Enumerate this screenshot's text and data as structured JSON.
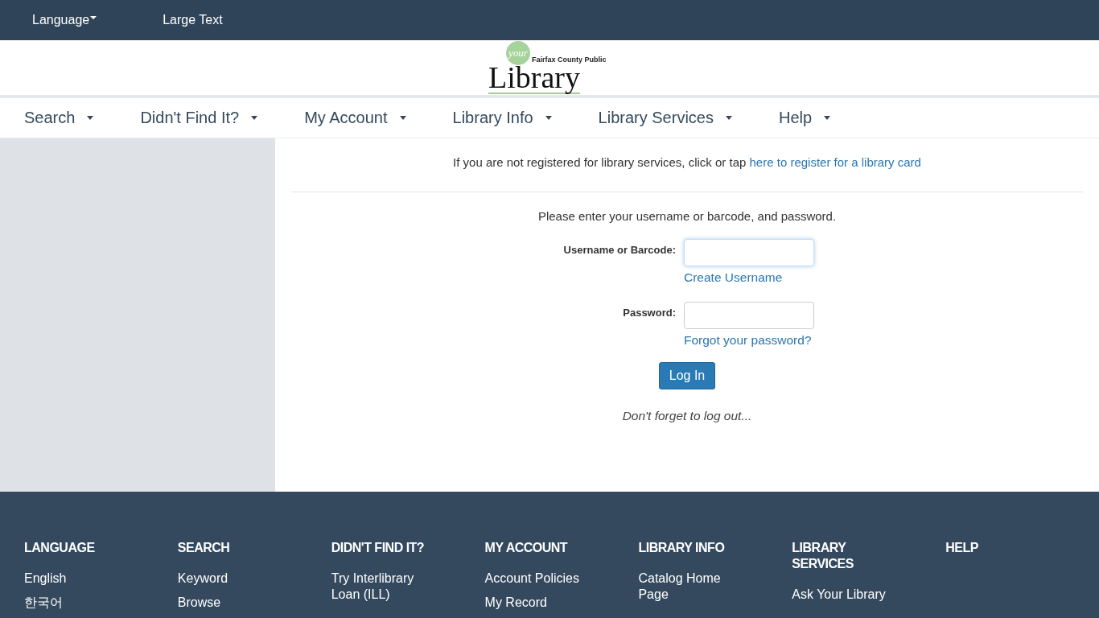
{
  "top_bar": {
    "items": [
      {
        "label": "Language",
        "dropdown": true
      },
      {
        "label": "Large Text",
        "dropdown": false
      }
    ]
  },
  "logo": {
    "badge": "your",
    "subtitle": "Fairfax County Public",
    "title": "Library"
  },
  "nav": [
    {
      "label": "Search"
    },
    {
      "label": "Didn't Find It?"
    },
    {
      "label": "My Account"
    },
    {
      "label": "Library Info"
    },
    {
      "label": "Library Services"
    },
    {
      "label": "Help"
    }
  ],
  "register_notice": {
    "text": "If you are not registered for library services, click or tap ",
    "link": "here to register for a library card"
  },
  "login": {
    "instructions": "Please enter your username or barcode, and password.",
    "fields": [
      {
        "label": "Username or Barcode:",
        "focused": true,
        "link": "Create Username"
      },
      {
        "label": "Password:",
        "focused": false,
        "link": "Forgot your password?"
      }
    ],
    "button": "Log In",
    "reminder": "Don't forget to log out..."
  },
  "footer": [
    {
      "heading": "LANGUAGE",
      "items": [
        "English",
        "한국어"
      ]
    },
    {
      "heading": "SEARCH",
      "items": [
        "Keyword",
        "Browse"
      ]
    },
    {
      "heading": "DIDN'T FIND IT?",
      "items": [
        "Try Interlibrary Loan (ILL)"
      ]
    },
    {
      "heading": "MY ACCOUNT",
      "items": [
        "Account Policies",
        "My Record"
      ]
    },
    {
      "heading": "LIBRARY INFO",
      "items": [
        "Catalog Home Page"
      ]
    },
    {
      "heading": "LIBRARY SERVICES",
      "items": [
        "Ask Your Library"
      ]
    },
    {
      "heading": "HELP"
    }
  ]
}
